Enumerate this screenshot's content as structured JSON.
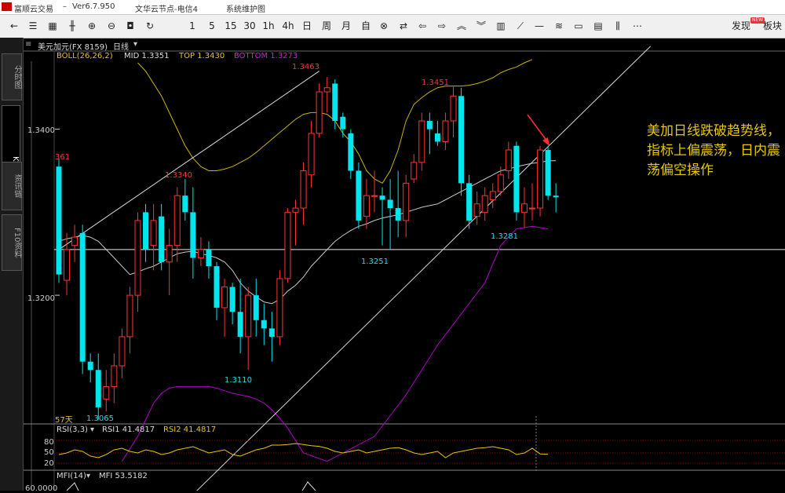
{
  "window": {
    "app_name": "富顺云交易",
    "version": "Ver6.7.950",
    "server": "文华云节点-电信4",
    "menu_system": "系统维护图"
  },
  "toolbar": {
    "items": [
      "1",
      "5",
      "15",
      "30",
      "1h",
      "4h",
      "日",
      "周",
      "月",
      "自"
    ],
    "discover": "发现",
    "new_badge": "NEW",
    "board": "板块"
  },
  "sidebar": {
    "tabs": [
      "分时图",
      "K线图",
      "资讯链",
      "F10资料"
    ]
  },
  "header": {
    "symbol": "美元加元(FX 8159)",
    "period": "日线"
  },
  "boll": {
    "label": "BOLL(26,26,2)",
    "mid": "MID 1.3351",
    "top": "TOP 1.3430",
    "bottom": "BOTTOM 1.3273"
  },
  "axis": {
    "y_labels": [
      "1.3400",
      "1.3200"
    ],
    "left_value": "361",
    "days": "57天"
  },
  "price_labels": {
    "high1": "1.3463",
    "high2": "1.3451",
    "mid_high": "1.3340",
    "low_left": "1.3065",
    "low_mid": "1.3110",
    "low_center": "1.3251",
    "low_right": "1.3281"
  },
  "rsi": {
    "label": "RSI(3,3)",
    "rsi1": "RSI1 41.4817",
    "rsi2": "RSI2 41.4817",
    "levels": [
      "80",
      "50",
      "20"
    ]
  },
  "mfi": {
    "label": "MFI(14)",
    "value": "MFI 53.5182",
    "axis": "60.0000"
  },
  "annotation": "美加日线跌破趋势线，指标上偏震荡，日内震荡偏空操作",
  "colors": {
    "up": "#ff3333",
    "down": "#00e5ee",
    "mid": "#c8c8c8",
    "top": "#c8b400",
    "bottom": "#b000c8",
    "annotation": "#e6c700"
  },
  "chart_data": {
    "type": "candlestick",
    "price_range": [
      1.3045,
      1.348
    ],
    "ohlc": [
      [
        1.3355,
        1.3365,
        1.3215,
        1.3225
      ],
      [
        1.3218,
        1.3275,
        1.32,
        1.3255
      ],
      [
        1.326,
        1.3285,
        1.324,
        1.327
      ],
      [
        1.3275,
        1.3285,
        1.3105,
        1.312
      ],
      [
        1.312,
        1.313,
        1.3095,
        1.311
      ],
      [
        1.311,
        1.313,
        1.305,
        1.3065
      ],
      [
        1.3075,
        1.311,
        1.306,
        1.309
      ],
      [
        1.309,
        1.313,
        1.307,
        1.3115
      ],
      [
        1.3115,
        1.316,
        1.31,
        1.315
      ],
      [
        1.315,
        1.321,
        1.313,
        1.32
      ],
      [
        1.32,
        1.33,
        1.318,
        1.329
      ],
      [
        1.33,
        1.331,
        1.324,
        1.3255
      ],
      [
        1.326,
        1.331,
        1.323,
        1.329
      ],
      [
        1.3295,
        1.331,
        1.323,
        1.324
      ],
      [
        1.324,
        1.328,
        1.32,
        1.326
      ],
      [
        1.326,
        1.333,
        1.324,
        1.332
      ],
      [
        1.332,
        1.334,
        1.329,
        1.33
      ],
      [
        1.33,
        1.333,
        1.322,
        1.3245
      ],
      [
        1.3245,
        1.327,
        1.3235,
        1.3255
      ],
      [
        1.3255,
        1.3265,
        1.322,
        1.3235
      ],
      [
        1.3235,
        1.324,
        1.317,
        1.3185
      ],
      [
        1.3185,
        1.322,
        1.315,
        1.321
      ],
      [
        1.321,
        1.3215,
        1.3165,
        1.318
      ],
      [
        1.318,
        1.322,
        1.313,
        1.315
      ],
      [
        1.315,
        1.321,
        1.311,
        1.32
      ],
      [
        1.32,
        1.322,
        1.315,
        1.317
      ],
      [
        1.317,
        1.319,
        1.314,
        1.316
      ],
      [
        1.316,
        1.318,
        1.312,
        1.315
      ],
      [
        1.315,
        1.323,
        1.314,
        1.322
      ],
      [
        1.322,
        1.3305,
        1.3215,
        1.33
      ],
      [
        1.33,
        1.3315,
        1.326,
        1.3305
      ],
      [
        1.3305,
        1.336,
        1.3285,
        1.335
      ],
      [
        1.3345,
        1.341,
        1.333,
        1.3395
      ],
      [
        1.3395,
        1.3455,
        1.339,
        1.3445
      ],
      [
        1.3445,
        1.3463,
        1.342,
        1.345
      ],
      [
        1.3455,
        1.346,
        1.34,
        1.341
      ],
      [
        1.3415,
        1.342,
        1.339,
        1.34
      ],
      [
        1.3395,
        1.34,
        1.334,
        1.335
      ],
      [
        1.335,
        1.336,
        1.328,
        1.329
      ],
      [
        1.3295,
        1.334,
        1.328,
        1.332
      ],
      [
        1.332,
        1.335,
        1.33,
        1.332
      ],
      [
        1.332,
        1.333,
        1.326,
        1.3315
      ],
      [
        1.3315,
        1.334,
        1.3255,
        1.3305
      ],
      [
        1.3305,
        1.335,
        1.327,
        1.329
      ],
      [
        1.329,
        1.3345,
        1.327,
        1.3335
      ],
      [
        1.334,
        1.337,
        1.3335,
        1.336
      ],
      [
        1.336,
        1.342,
        1.335,
        1.341
      ],
      [
        1.341,
        1.342,
        1.337,
        1.34
      ],
      [
        1.3395,
        1.341,
        1.338,
        1.3385
      ],
      [
        1.3385,
        1.342,
        1.3375,
        1.341
      ],
      [
        1.341,
        1.3451,
        1.339,
        1.344
      ],
      [
        1.344,
        1.345,
        1.332,
        1.3335
      ],
      [
        1.3335,
        1.3345,
        1.328,
        1.329
      ],
      [
        1.3295,
        1.3325,
        1.3285,
        1.331
      ],
      [
        1.33,
        1.333,
        1.329,
        1.332
      ],
      [
        1.3315,
        1.3335,
        1.3305,
        1.3325
      ],
      [
        1.3325,
        1.3355,
        1.332,
        1.3345
      ],
      [
        1.335,
        1.3385,
        1.334,
        1.3375
      ],
      [
        1.338,
        1.3385,
        1.329,
        1.33
      ],
      [
        1.33,
        1.333,
        1.3281,
        1.331
      ],
      [
        1.3305,
        1.3335,
        1.329,
        1.3305
      ],
      [
        1.3305,
        1.338,
        1.3295,
        1.3375
      ],
      [
        1.3375,
        1.338,
        1.3315,
        1.332
      ],
      [
        1.332,
        1.3335,
        1.33,
        1.3318
      ]
    ],
    "boll_mid": [
      1.3265,
      1.3268,
      1.327,
      1.3272,
      1.327,
      1.3265,
      1.3255,
      1.3245,
      1.3235,
      1.3225,
      1.3228,
      1.3232,
      1.3235,
      1.324,
      1.3245,
      1.325,
      1.3252,
      1.3253,
      1.325,
      1.3248,
      1.3245,
      1.324,
      1.323,
      1.3215,
      1.3205,
      1.3198,
      1.3192,
      1.319,
      1.3195,
      1.3205,
      1.3212,
      1.3222,
      1.3235,
      1.3245,
      1.3255,
      1.3265,
      1.3272,
      1.3278,
      1.3283,
      1.3286,
      1.329,
      1.3293,
      1.3295,
      1.3297,
      1.33,
      1.3303,
      1.3306,
      1.3308,
      1.331,
      1.3315,
      1.332,
      1.3325,
      1.333,
      1.3335,
      1.334,
      1.3345,
      1.335,
      1.3352,
      1.3355,
      1.3357,
      1.3359,
      1.336,
      1.3362,
      1.3362
    ],
    "boll_top": [
      1.348,
      1.347,
      1.3455,
      1.344,
      1.342,
      1.34,
      1.338,
      1.3365,
      1.3355,
      1.335,
      1.335,
      1.3352,
      1.3355,
      1.336,
      1.3365,
      1.3372,
      1.338,
      1.3388,
      1.3396,
      1.3404,
      1.3412,
      1.3418,
      1.342,
      1.342,
      1.3418,
      1.341,
      1.3395,
      1.3385,
      1.337,
      1.335,
      1.334,
      1.3335,
      1.335,
      1.3375,
      1.341,
      1.343,
      1.3438,
      1.3445,
      1.345,
      1.3452,
      1.3452,
      1.3452,
      1.3453,
      1.3455,
      1.3458,
      1.3462,
      1.3468,
      1.3472,
      1.3475,
      1.348,
      1.3484
    ],
    "boll_bottom": [
      1.3,
      1.3015,
      1.303,
      1.305,
      1.307,
      1.3082,
      1.3088,
      1.309,
      1.309,
      1.309,
      1.309,
      1.309,
      1.3088,
      1.3085,
      1.3082,
      1.308,
      1.3078,
      1.3075,
      1.307,
      1.3062,
      1.3052,
      1.304,
      1.3025,
      1.301
    ],
    "trend_lines": [
      [
        [
          0,
          1.3255
        ],
        [
          33,
          1.347
        ]
      ],
      [
        [
          17,
          1.296
        ],
        [
          75,
          1.35
        ]
      ]
    ],
    "hline": 1.3255,
    "rsi_series": [
      40,
      45,
      55,
      50,
      35,
      30,
      40,
      55,
      60,
      50,
      45,
      55,
      50,
      40,
      45,
      55,
      60,
      65,
      55,
      45,
      50,
      55,
      40,
      35,
      45,
      55,
      60,
      70,
      70,
      72,
      75,
      72,
      68,
      66,
      60,
      50,
      45,
      50,
      55,
      45,
      50,
      55,
      60,
      62,
      55,
      45,
      40,
      45,
      50,
      30,
      45,
      50,
      55,
      60,
      62,
      65,
      60,
      55,
      40,
      45,
      60,
      42,
      41
    ]
  }
}
